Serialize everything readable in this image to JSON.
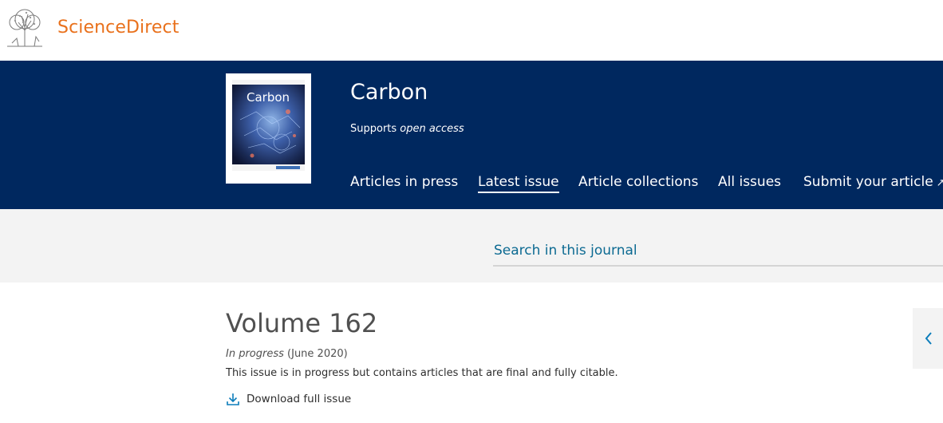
{
  "header": {
    "brand": "ScienceDirect",
    "logo_icon": "elsevier-tree-icon",
    "brand_color": "#e9711c"
  },
  "journal": {
    "title": "Carbon",
    "oa_prefix": "Supports ",
    "oa_text": "open access",
    "banner_color": "#00285f"
  },
  "nav": {
    "items": [
      {
        "label": "Articles in press"
      },
      {
        "label": "Latest issue",
        "active": true
      },
      {
        "label": "Article collections"
      },
      {
        "label": "All issues"
      },
      {
        "label": "Submit your article",
        "icon": "external-link-icon"
      }
    ]
  },
  "search": {
    "placeholder": "Search in this journal"
  },
  "volume": {
    "title": "Volume 162",
    "status": "In progress",
    "date": " (June 2020)",
    "description": "This issue is in progress but contains articles that are final and fully citable.",
    "download_label": "Download full issue",
    "download_icon": "download-icon"
  },
  "pager": {
    "prev_icon": "chevron-left-icon"
  }
}
